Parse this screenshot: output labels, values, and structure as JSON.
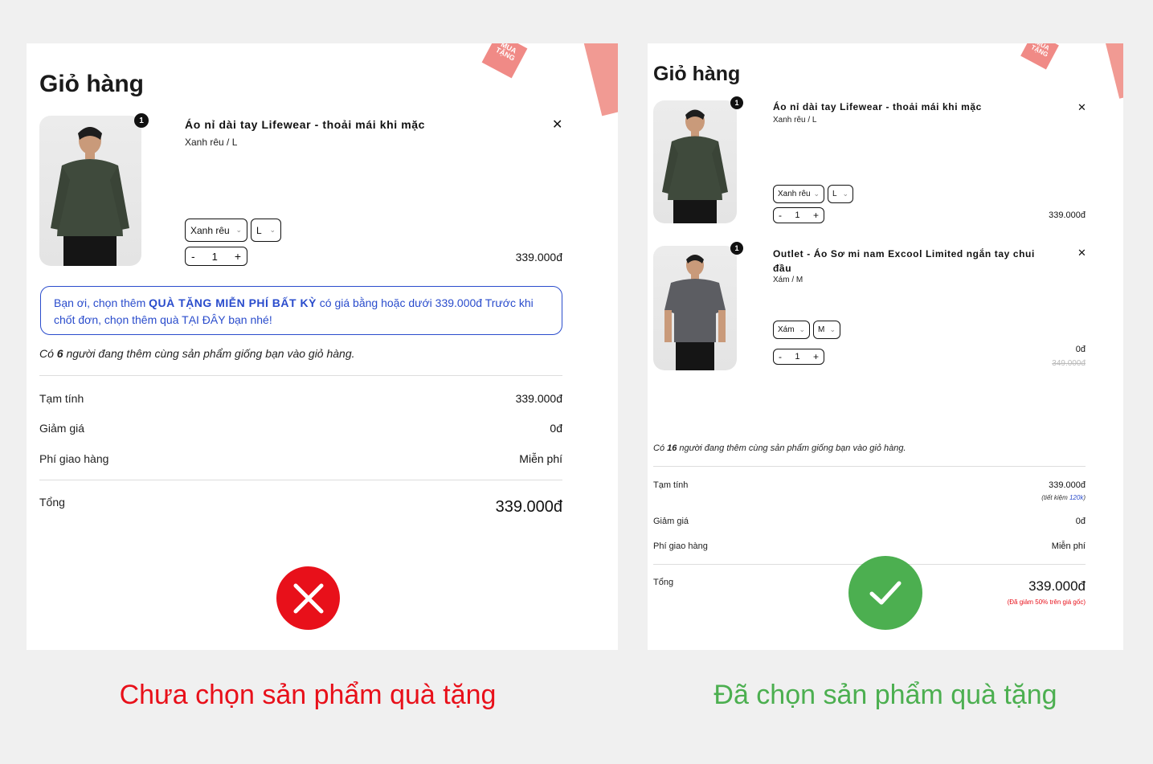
{
  "colors": {
    "red": "#e8101a",
    "green": "#4caf50",
    "blue": "#2a4ccc"
  },
  "left": {
    "title": "Giỏ hàng",
    "product": {
      "qty_badge": "1",
      "name": "Áo nỉ dài tay Lifewear - thoải mái khi mặc",
      "variant": "Xanh rêu / L",
      "color_select": "Xanh rêu",
      "size_select": "L",
      "quantity": "1",
      "price": "339.000đ"
    },
    "notice": {
      "prefix": "Bạn ơi, chọn thêm ",
      "highlight": "QUÀ TẶNG MIỄN PHÍ BẤT KỲ",
      "suffix": " có giá bằng hoặc dưới 339.000đ Trước khi chốt đơn, chọn thêm quà TẠI ĐÂY bạn nhé!"
    },
    "social_prefix": "Có ",
    "social_count": "6",
    "social_suffix": " người đang thêm cùng sản phẩm giống bạn vào giỏ hàng.",
    "subtotal_label": "Tạm tính",
    "subtotal_value": "339.000đ",
    "discount_label": "Giảm giá",
    "discount_value": "0đ",
    "shipping_label": "Phí giao hàng",
    "shipping_value": "Miễn phí",
    "total_label": "Tổng",
    "total_value": "339.000đ",
    "status_icon": "x-icon",
    "caption": "Chưa chọn sản phẩm quà tặng"
  },
  "right": {
    "title": "Giỏ hàng",
    "products": [
      {
        "qty_badge": "1",
        "name": "Áo nỉ dài tay Lifewear - thoải mái khi mặc",
        "variant": "Xanh rêu / L",
        "color_select": "Xanh rêu",
        "size_select": "L",
        "quantity": "1",
        "price": "339.000đ"
      },
      {
        "qty_badge": "1",
        "name_line1": "Outlet - Áo Sơ mi nam Excool Limited ngắn tay chui",
        "name_line2": "đầu",
        "variant": "Xám / M",
        "color_select": "Xám",
        "size_select": "M",
        "quantity": "1",
        "price": "0đ",
        "original_price": "349.000đ"
      }
    ],
    "social_prefix": "Có ",
    "social_count": "16",
    "social_suffix": " người đang thêm cùng sản phẩm giống bạn vào giỏ hàng.",
    "subtotal_label": "Tạm tính",
    "subtotal_value": "339.000đ",
    "savings_prefix": "(tiết kiệm ",
    "savings_amount": "120k",
    "savings_suffix": ")",
    "discount_label": "Giảm giá",
    "discount_value": "0đ",
    "shipping_label": "Phí giao hàng",
    "shipping_value": "Miễn phí",
    "total_label": "Tổng",
    "total_value": "339.000đ",
    "total_note": "(Đã giảm 50% trên giá gốc)",
    "status_icon": "check-icon",
    "caption": "Đã chọn sản phẩm quà tặng"
  }
}
